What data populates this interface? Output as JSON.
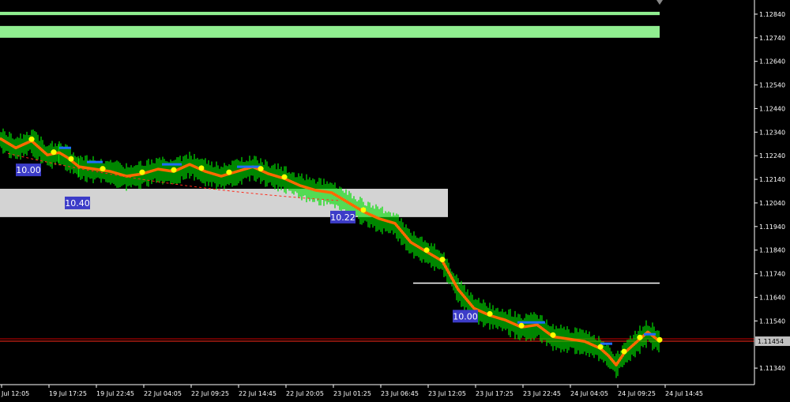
{
  "chart_data": {
    "type": "line",
    "price_scale": {
      "ylim": [
        1.1127,
        1.129
      ],
      "ticks": [
        "1.12840",
        "1.12740",
        "1.12640",
        "1.12540",
        "1.12440",
        "1.12340",
        "1.12240",
        "1.12140",
        "1.12040",
        "1.11940",
        "1.11840",
        "1.11740",
        "1.11640",
        "1.11540",
        "1.11340"
      ],
      "current_price": "1.11454"
    },
    "time_axis": {
      "labels": [
        "Jul 12:05",
        "19 Jul 17:25",
        "19 Jul 22:45",
        "22 Jul 04:05",
        "22 Jul 09:25",
        "22 Jul 14:45",
        "22 Jul 20:05",
        "23 Jul 01:25",
        "23 Jul 06:45",
        "23 Jul 12:05",
        "23 Jul 17:25",
        "23 Jul 22:45",
        "24 Jul 04:05",
        "24 Jul 09:25",
        "24 Jul 14:45"
      ]
    },
    "series": [
      {
        "values": [
          [
            0,
            1.1232
          ],
          [
            20,
            1.1228
          ],
          [
            40,
            1.1231
          ],
          [
            60,
            1.1225
          ],
          [
            75,
            1.1226
          ],
          [
            85,
            1.1224
          ],
          [
            100,
            1.122
          ],
          [
            120,
            1.1219
          ],
          [
            140,
            1.1218
          ],
          [
            160,
            1.1216
          ],
          [
            180,
            1.1217
          ],
          [
            200,
            1.1219
          ],
          [
            220,
            1.1218
          ],
          [
            240,
            1.1221
          ],
          [
            260,
            1.1218
          ],
          [
            280,
            1.1216
          ],
          [
            300,
            1.1218
          ],
          [
            320,
            1.122
          ],
          [
            340,
            1.1217
          ],
          [
            360,
            1.1215
          ],
          [
            380,
            1.1212
          ],
          [
            400,
            1.121
          ],
          [
            420,
            1.1209
          ],
          [
            440,
            1.1205
          ],
          [
            460,
            1.1201
          ],
          [
            480,
            1.1198
          ],
          [
            500,
            1.1196
          ],
          [
            520,
            1.1188
          ],
          [
            540,
            1.1184
          ],
          [
            560,
            1.118
          ],
          [
            580,
            1.1168
          ],
          [
            600,
            1.116
          ],
          [
            620,
            1.1157
          ],
          [
            640,
            1.1155
          ],
          [
            660,
            1.1152
          ],
          [
            680,
            1.1153
          ],
          [
            700,
            1.1148
          ],
          [
            720,
            1.1147
          ],
          [
            740,
            1.1146
          ],
          [
            760,
            1.1143
          ],
          [
            770,
            1.114
          ],
          [
            780,
            1.1136
          ],
          [
            790,
            1.1141
          ],
          [
            800,
            1.1144
          ],
          [
            810,
            1.1147
          ],
          [
            820,
            1.115
          ],
          [
            835,
            1.1146
          ]
        ]
      }
    ],
    "zones": [
      {
        "color": "#90ee90",
        "price_top": 1.1285,
        "price_bottom": 1.12836,
        "x_to": 835
      },
      {
        "color": "#90ee90",
        "price_top": 1.1279,
        "price_bottom": 1.1274,
        "x_to": 835
      },
      {
        "color": "#d3d3d3",
        "price_top": 1.121,
        "price_bottom": 1.1198,
        "x_to": 567
      }
    ],
    "level_lines": [
      {
        "color": "#ffffff",
        "price": 1.117,
        "x_from": 523,
        "x_to": 835
      }
    ],
    "markers": [
      {
        "text": "10.00",
        "x": 36,
        "price": 1.1218
      },
      {
        "text": "10.40",
        "x": 98,
        "price": 1.1204
      },
      {
        "text": "10.22",
        "x": 434,
        "price": 1.1198
      },
      {
        "text": "10.00",
        "x": 589,
        "price": 1.1156
      }
    ],
    "colors": {
      "background": "#000000",
      "price_line": "#ff2a1a",
      "bid_line": "#cc0000",
      "zone_green": "#90ee90",
      "zone_grey": "#d3d3d3",
      "marker": "#3c3cc8",
      "dot": "#ffff00",
      "candles": "#00e000",
      "trend": "#ff6a00"
    },
    "grid": false
  }
}
